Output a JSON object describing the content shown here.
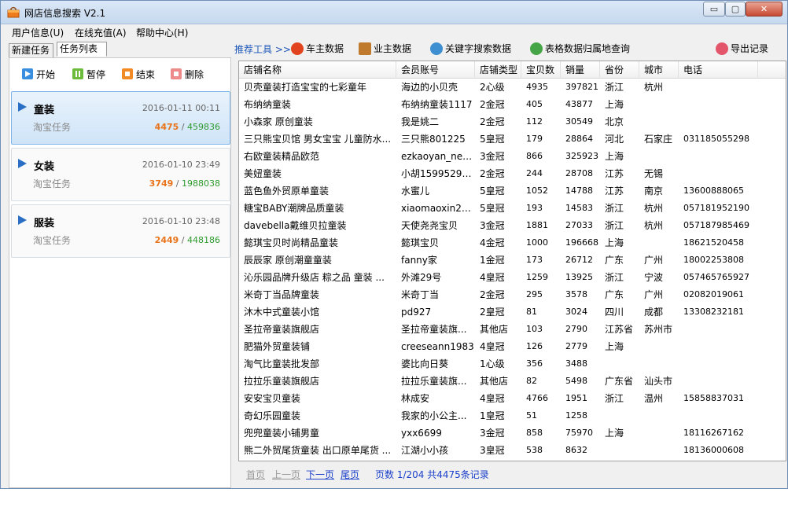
{
  "window": {
    "title": "网店信息搜索 V2.1",
    "controls": {
      "minimize": "▭",
      "maximize": "▢",
      "close": "✕"
    }
  },
  "menu": [
    "用户信息(U)",
    "在线充值(A)",
    "帮助中心(H)"
  ],
  "tabs": {
    "new_task": "新建任务",
    "task_list": "任务列表"
  },
  "actions": {
    "start": "开始",
    "pause": "暂停",
    "end": "结束",
    "delete": "删除"
  },
  "tasks": [
    {
      "name": "童装",
      "date": "2016-01-11 00:11",
      "source": "淘宝任务",
      "done": "4475",
      "sep": " / ",
      "total": "459836",
      "selected": true
    },
    {
      "name": "女装",
      "date": "2016-01-10 23:49",
      "source": "淘宝任务",
      "done": "3749",
      "sep": " / ",
      "total": "1988038",
      "selected": false
    },
    {
      "name": "服装",
      "date": "2016-01-10 23:48",
      "source": "淘宝任务",
      "done": "2449",
      "sep": " / ",
      "total": "448186",
      "selected": false
    }
  ],
  "toolbar": {
    "recommend": "推荐工具 >>",
    "car_data": "车主数据",
    "owner_data": "业主数据",
    "keyword_data": "关键字搜索数据",
    "table_location": "表格数据归属地查询",
    "export": "导出记录",
    "colors": {
      "car": "#e2431f",
      "owner": "#c07a2e",
      "keyword": "#3d8fd1",
      "table": "#45a445",
      "export": "#e3556a"
    }
  },
  "table": {
    "columns": [
      "店铺名称",
      "会员账号",
      "店铺类型",
      "宝贝数",
      "销量",
      "省份",
      "城市",
      "电话"
    ],
    "rows": [
      [
        "贝壳童装打造宝宝的七彩童年",
        "海边的小贝壳",
        "2心级",
        "4935",
        "397821",
        "浙江",
        "杭州",
        ""
      ],
      [
        "布纳纳童装",
        "布纳纳童装1117",
        "2金冠",
        "405",
        "43877",
        "上海",
        "",
        ""
      ],
      [
        "小森家 原创童装",
        "我是姚二",
        "2金冠",
        "112",
        "30549",
        "北京",
        "",
        ""
      ],
      [
        "三只熊宝贝馆 男女宝宝 儿童防水...",
        "三只熊801225",
        "5皇冠",
        "179",
        "28864",
        "河北",
        "石家庄",
        "031185055298"
      ],
      [
        "右欧童装精品欧范",
        "ezkaoyan_new...",
        "3金冠",
        "866",
        "325923",
        "上海",
        "",
        ""
      ],
      [
        "美妞童装",
        "小胡15995294...",
        "2金冠",
        "244",
        "28708",
        "江苏",
        "无锡",
        ""
      ],
      [
        "蓝色鱼外贸原单童装",
        "水蜜儿",
        "5皇冠",
        "1052",
        "14788",
        "江苏",
        "南京",
        "13600888065"
      ],
      [
        "糖宝BABY潮牌品质童装",
        "xiaomaoxin2008",
        "5皇冠",
        "193",
        "14583",
        "浙江",
        "杭州",
        "057181952190"
      ],
      [
        "davebella戴维贝拉童装",
        "天使尧尧宝贝",
        "3金冠",
        "1881",
        "27033",
        "浙江",
        "杭州",
        "057187985469"
      ],
      [
        "懿琪宝贝时尚精品童装",
        "懿琪宝贝",
        "4金冠",
        "1000",
        "196668",
        "上海",
        "",
        "18621520458"
      ],
      [
        "辰辰家 原创潮童童装",
        "fanny家",
        "1金冠",
        "173",
        "26712",
        "广东",
        "广州",
        "18002253808"
      ],
      [
        "沁乐园品牌升级店  粽之品 童装 ...",
        "外滩29号",
        "4皇冠",
        "1259",
        "13925",
        "浙江",
        "宁波",
        "057465765927"
      ],
      [
        "米奇丁当品牌童装",
        "米奇丁当",
        "2金冠",
        "295",
        "3578",
        "广东",
        "广州",
        "02082019061"
      ],
      [
        "沐木中式童装小馆",
        "pd927",
        "2皇冠",
        "81",
        "3024",
        "四川",
        "成都",
        "13308232181"
      ],
      [
        "圣拉帝童装旗舰店",
        "圣拉帝童装旗...",
        "其他店",
        "103",
        "2790",
        "江苏省",
        "苏州市",
        ""
      ],
      [
        "肥猫外贸童装铺",
        "creeseann1983",
        "4皇冠",
        "126",
        "2779",
        "上海",
        "",
        ""
      ],
      [
        "淘气比童装批发部",
        "婆比向日葵",
        "1心级",
        "356",
        "3488",
        "",
        "",
        ""
      ],
      [
        "拉拉乐童装旗舰店",
        "拉拉乐童装旗...",
        "其他店",
        "82",
        "5498",
        "广东省",
        "汕头市",
        ""
      ],
      [
        "安安宝贝童装",
        "林成安",
        "4皇冠",
        "4766",
        "1951",
        "浙江",
        "温州",
        "15858837031"
      ],
      [
        "奇幻乐园童装",
        "我家的小公主...",
        "1皇冠",
        "51",
        "1258",
        "",
        "",
        ""
      ],
      [
        "兜兜童装小铺男童",
        "yxx6699",
        "3金冠",
        "858",
        "75970",
        "上海",
        "",
        "18116267162"
      ],
      [
        "熊二外贸尾货童装 出口原单尾货 ...",
        "江湖小小孩",
        "3皇冠",
        "538",
        "8632",
        "",
        "",
        "18136000608"
      ]
    ]
  },
  "pager": {
    "first": "首页",
    "prev": "上一页",
    "next": "下一页",
    "last": "尾页",
    "info": "页数 1/204 共4475条记录"
  }
}
